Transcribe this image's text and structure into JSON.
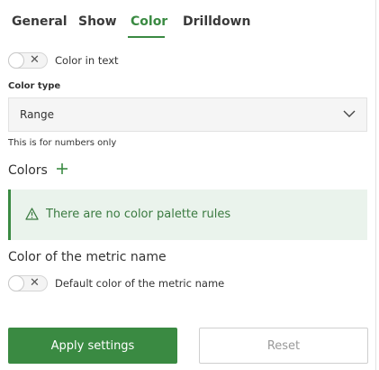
{
  "tabs": [
    {
      "label": "General",
      "active": false
    },
    {
      "label": "Show",
      "active": false
    },
    {
      "label": "Color",
      "active": true
    },
    {
      "label": "Drilldown",
      "active": false
    }
  ],
  "color_in_text": {
    "label": "Color in text",
    "enabled": false,
    "icon": "x-icon"
  },
  "color_type": {
    "label": "Color type",
    "selected": "Range",
    "hint": "This is for numbers only"
  },
  "colors": {
    "title": "Colors",
    "add_icon": "plus-icon",
    "empty_message": "There are no color palette rules",
    "empty_icon": "warning-icon"
  },
  "metric_name_color": {
    "title": "Color of the metric name",
    "toggle_label": "Default color of the metric name",
    "enabled": false
  },
  "actions": {
    "apply_label": "Apply settings",
    "reset_label": "Reset"
  },
  "colors_palette": {
    "accent": "#3a8a42",
    "alert_bg": "#eaf3ec",
    "select_bg": "#f5f5f5"
  }
}
